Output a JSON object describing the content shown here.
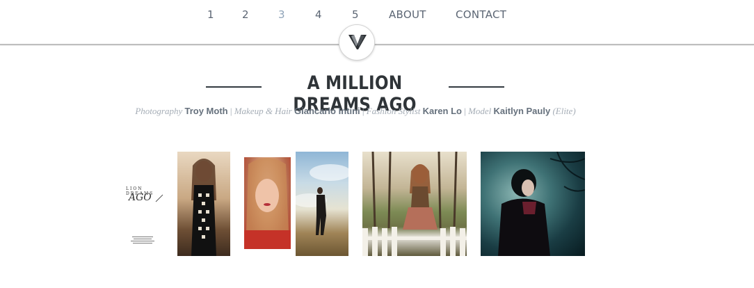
{
  "nav": {
    "items": [
      {
        "label": "1"
      },
      {
        "label": "2"
      },
      {
        "label": "3"
      },
      {
        "label": "4"
      },
      {
        "label": "5"
      },
      {
        "label": "ABOUT"
      },
      {
        "label": "CONTACT"
      }
    ],
    "active_label": "3",
    "logo_letter": "V"
  },
  "article": {
    "title": "A MILLION DREAMS AGO",
    "credits": [
      {
        "role": "Photography",
        "name": "Troy Moth"
      },
      {
        "role": "Makeup & Hair",
        "name": "Giancarlo Intini"
      },
      {
        "role": "Fashion Stylist",
        "name": "Karen Lo"
      },
      {
        "role": "Model",
        "name": "Kaitlyn Pauly",
        "note": "(Elite)"
      }
    ],
    "separator": "|"
  },
  "gallery": {
    "cover": {
      "heading": "LION DREAMS",
      "logo": "AGO"
    }
  },
  "colors": {
    "nav_text": "#5b6573",
    "nav_active": "#8fa3b8",
    "title": "#2f3438",
    "credit_role": "#a5adb6",
    "credit_name": "#65707c"
  }
}
